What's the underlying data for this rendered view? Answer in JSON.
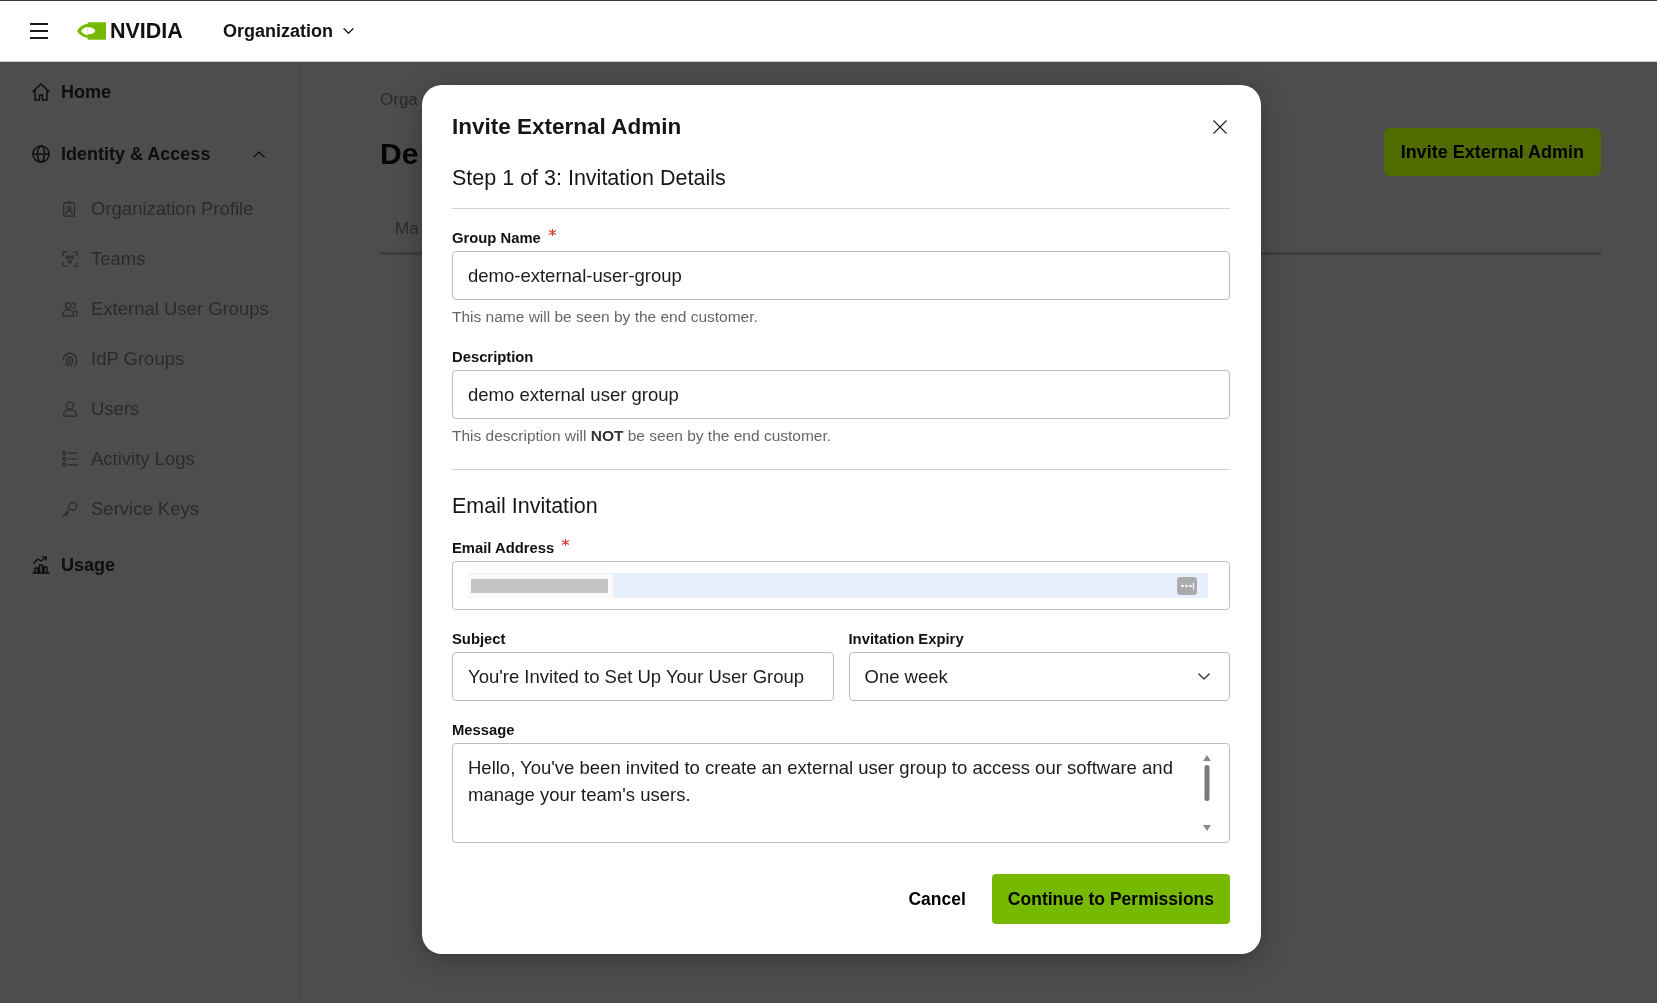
{
  "header": {
    "brand": "NVIDIA",
    "org_menu": {
      "label": "Organization"
    }
  },
  "sidebar": {
    "items": [
      {
        "label": "Home",
        "kind": "link",
        "selected": false
      },
      {
        "label": "Identity & Access",
        "kind": "group",
        "selected": false,
        "expanded": true,
        "children": [
          {
            "label": "Organization Profile",
            "selected": false
          },
          {
            "label": "Teams",
            "selected": false
          },
          {
            "label": "External User Groups",
            "selected": false
          },
          {
            "label": "IdP Groups",
            "selected": false
          },
          {
            "label": "Users",
            "selected": false
          },
          {
            "label": "Activity Logs",
            "selected": false
          },
          {
            "label": "Service Keys",
            "selected": false
          }
        ]
      },
      {
        "label": "Usage",
        "kind": "link",
        "selected": false
      }
    ]
  },
  "page": {
    "breadcrumb": "Orga",
    "title": "De",
    "tabs": [
      {
        "label": "Ma"
      }
    ],
    "action_button": "Invite External Admin"
  },
  "modal": {
    "title": "Invite External Admin",
    "step": "Step 1 of 3: Invitation Details",
    "sections": [
      {
        "fields": [
          {
            "kind": "text",
            "label": "Group Name",
            "required": true,
            "value": "demo-external-user-group",
            "help": "This name will be seen by the end customer."
          },
          {
            "kind": "text",
            "label": "Description",
            "required": false,
            "value": "demo external user group",
            "help": "This description will **NOT** be seen by the end customer."
          }
        ]
      },
      {
        "heading": "Email Invitation",
        "fields": [
          {
            "kind": "text",
            "label": "Email Address",
            "required": true,
            "autofilled": true,
            "redacted": true
          },
          {
            "kind": "row",
            "fields": [
              {
                "kind": "text",
                "label": "Subject",
                "required": false,
                "value": "You're Invited to Set Up Your User Group"
              },
              {
                "kind": "select",
                "label": "Invitation Expiry",
                "required": false,
                "value": "One week"
              }
            ]
          },
          {
            "kind": "textarea",
            "label": "Message",
            "required": false,
            "value": "Hello, You've been invited to create an external user group to access our software and manage your team's users."
          }
        ]
      }
    ],
    "buttons": [
      {
        "label": "Cancel",
        "kind": "secondary"
      },
      {
        "label": "Continue to Permissions",
        "kind": "primary"
      }
    ]
  }
}
